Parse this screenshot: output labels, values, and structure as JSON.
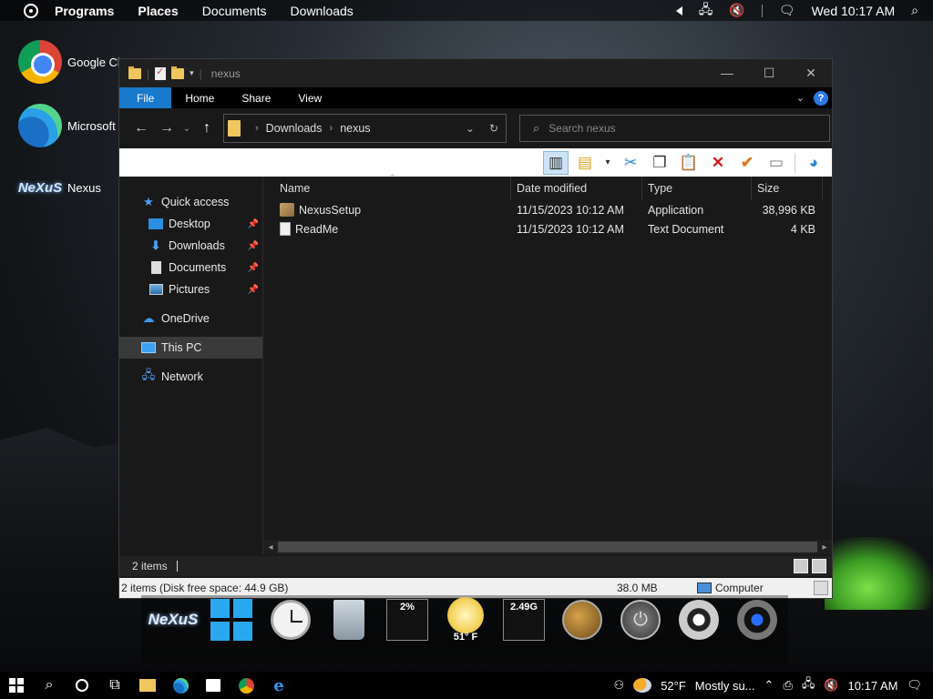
{
  "menubar": {
    "items": [
      "Programs",
      "Places",
      "Documents",
      "Downloads"
    ],
    "clock": "Wed 10:17 AM"
  },
  "desktop_icons": [
    {
      "label": "Google Ch",
      "icon": "chrome-icon"
    },
    {
      "label": "Microsoft E",
      "icon": "edge-icon"
    },
    {
      "label": "Nexus",
      "icon": "nexus-icon"
    }
  ],
  "explorer": {
    "title": "nexus",
    "ribbon_tabs": [
      "File",
      "Home",
      "Share",
      "View"
    ],
    "address": {
      "segments": [
        "Downloads",
        "nexus"
      ]
    },
    "search_placeholder": "Search nexus",
    "sidebar": {
      "quick_access": "Quick access",
      "pinned": [
        "Desktop",
        "Downloads",
        "Documents",
        "Pictures"
      ],
      "onedrive": "OneDrive",
      "this_pc": "This PC",
      "network": "Network"
    },
    "columns": {
      "name": "Name",
      "date": "Date modified",
      "type": "Type",
      "size": "Size"
    },
    "files": [
      {
        "name": "NexusSetup",
        "date": "11/15/2023 10:12 AM",
        "type": "Application",
        "size": "38,996 KB"
      },
      {
        "name": "ReadMe",
        "date": "11/15/2023 10:12 AM",
        "type": "Text Document",
        "size": "4 KB"
      }
    ],
    "status_count": "2 items",
    "status2": {
      "info": "2 items (Disk free space: 44.9 GB)",
      "size": "38.0 MB",
      "location": "Computer"
    }
  },
  "dock": {
    "cpu": "2%",
    "weather_temp": "51° F",
    "memory": "2.49G"
  },
  "taskbar": {
    "weather": "52°F",
    "weather_desc": "Mostly su...",
    "clock": "10:17 AM"
  }
}
